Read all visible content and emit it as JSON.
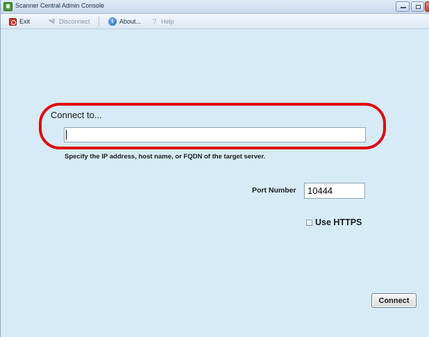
{
  "window": {
    "title": "Scanner Central Admin Console"
  },
  "menu": {
    "exit": "Exit",
    "disconnect": "Disconnect",
    "about": "About...",
    "help": "Help"
  },
  "form": {
    "connect_label": "Connect to...",
    "host_value": "",
    "hint": "Specify the IP address, host name, or FQDN of the target server.",
    "port_label": "Port Number",
    "port_value": "10444",
    "https_label": "Use HTTPS",
    "https_checked": false,
    "connect_button": "Connect"
  },
  "colors": {
    "background": "#d6ebf6",
    "highlight_ring": "#e0000f"
  },
  "icons": {
    "app": "scanner-app-icon",
    "exit": "exit-icon",
    "disconnect": "disconnect-icon",
    "about": "info-icon",
    "help": "help-icon"
  }
}
